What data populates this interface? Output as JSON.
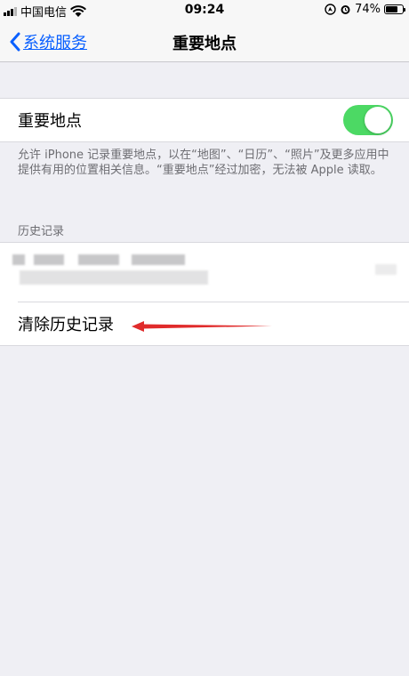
{
  "status_bar": {
    "carrier": "中国电信",
    "time": "09:24",
    "battery_percent": "74%",
    "battery_level": 0.74,
    "icons": [
      "signal-icon",
      "wifi-icon",
      "location-icon",
      "alarm-icon",
      "battery-icon"
    ]
  },
  "nav": {
    "back_label": "系统服务",
    "title": "重要地点",
    "accent_color": "#0a60ff"
  },
  "toggle": {
    "label": "重要地点",
    "state": "on",
    "on_color": "#4cd964"
  },
  "description": "允许 iPhone 记录重要地点，以在“地图”、“日历”、“照片”及更多应用中提供有用的位置相关信息。“重要地点”经过加密，无法被 Apple 读取。",
  "history": {
    "section_title": "历史记录",
    "clear_label": "清除历史记录"
  }
}
